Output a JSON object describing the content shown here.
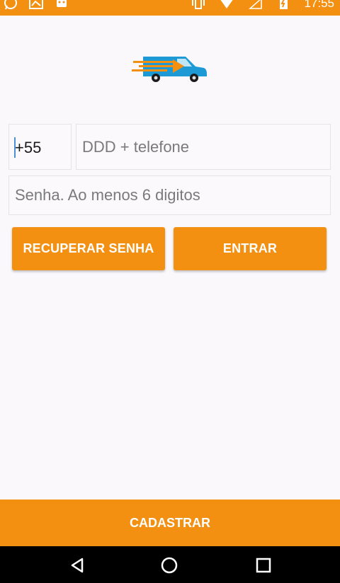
{
  "status_bar": {
    "time": "17:55",
    "left_icons": [
      "whatsapp-icon",
      "image-icon",
      "message-icon"
    ],
    "right_icons": [
      "vibrate-icon",
      "wifi-icon",
      "no-signal-icon",
      "battery-icon"
    ]
  },
  "login": {
    "country_code": "+55",
    "phone_placeholder": "DDD + telefone",
    "password_placeholder": "Senha. Ao menos 6 digitos",
    "recover_label": "RECUPERAR SENHA",
    "enter_label": "ENTRAR"
  },
  "footer": {
    "register_label": "CADASTRAR"
  },
  "nav": {
    "icons": [
      "back-icon",
      "home-icon",
      "recent-apps-icon"
    ]
  },
  "colors": {
    "accent": "#f39011",
    "background": "#faf8fb",
    "logo_blue": "#1d9ad6",
    "logo_orange": "#f39011"
  }
}
